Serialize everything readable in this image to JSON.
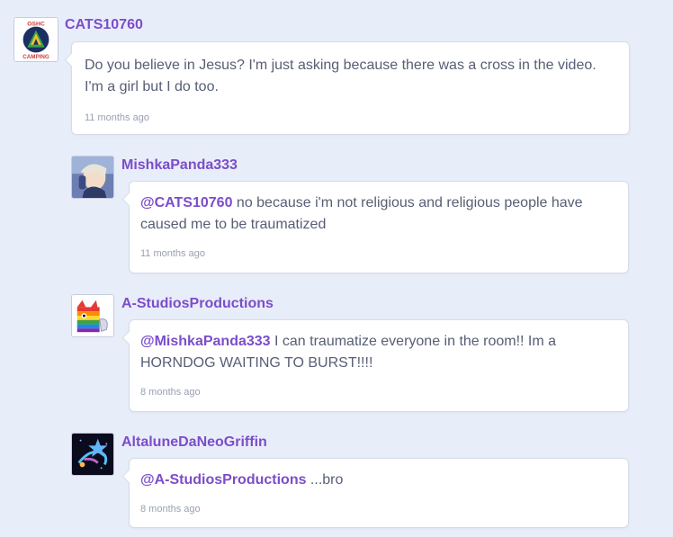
{
  "comments": [
    {
      "username": "CATS10760",
      "avatar_icon": "camping-badge-avatar",
      "avatar_text": "OSHC CAMPING",
      "mention": "",
      "text": "Do you believe in Jesus? I'm just asking because there was a cross in the video. I'm a girl but I do too.",
      "time": "11 months ago"
    },
    {
      "username": "MishkaPanda333",
      "avatar_icon": "anime-character-avatar",
      "mention": "@CATS10760",
      "text": " no because i'm not religious and religious people have caused me to be traumatized",
      "time": "11 months ago"
    },
    {
      "username": "A-StudiosProductions",
      "avatar_icon": "rainbow-cat-avatar",
      "mention": "@MishkaPanda333",
      "text": " I can traumatize everyone in the room!! Im a HORNDOG WAITING TO BURST!!!!",
      "time": "8 months ago"
    },
    {
      "username": "AltaluneDaNeoGriffin",
      "avatar_icon": "neon-griffin-avatar",
      "mention": "@A-StudiosProductions",
      "text": " ...bro",
      "time": "8 months ago"
    }
  ],
  "colors": {
    "page_bg": "#e8edfa",
    "accent": "#7c4dc9",
    "body_text": "#575e75",
    "timestamp": "#9aa0b3"
  }
}
